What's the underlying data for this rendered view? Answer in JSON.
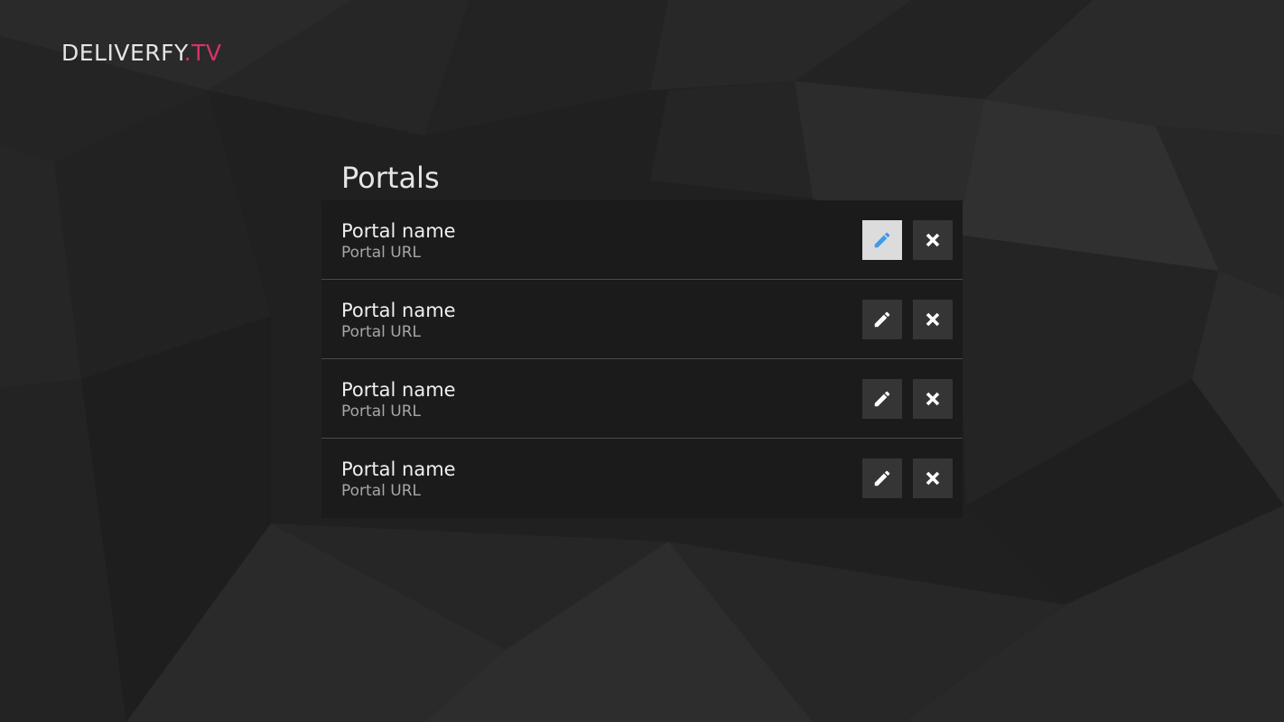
{
  "app": {
    "logo_main": "DELIVERFY",
    "logo_accent": ".TV",
    "accent_color": "#d6336c"
  },
  "portals": {
    "title": "Portals",
    "items": [
      {
        "name": "Portal name",
        "url": "Portal URL",
        "edit_icon": "pencil-icon",
        "delete_icon": "close-icon",
        "focused": "edit"
      },
      {
        "name": "Portal name",
        "url": "Portal URL",
        "edit_icon": "pencil-icon",
        "delete_icon": "close-icon"
      },
      {
        "name": "Portal name",
        "url": "Portal URL",
        "edit_icon": "pencil-icon",
        "delete_icon": "close-icon"
      },
      {
        "name": "Portal name",
        "url": "Portal URL",
        "edit_icon": "pencil-icon",
        "delete_icon": "close-icon"
      }
    ]
  },
  "colors": {
    "focus_icon": "#3d9be9",
    "icon": "#ffffff"
  }
}
